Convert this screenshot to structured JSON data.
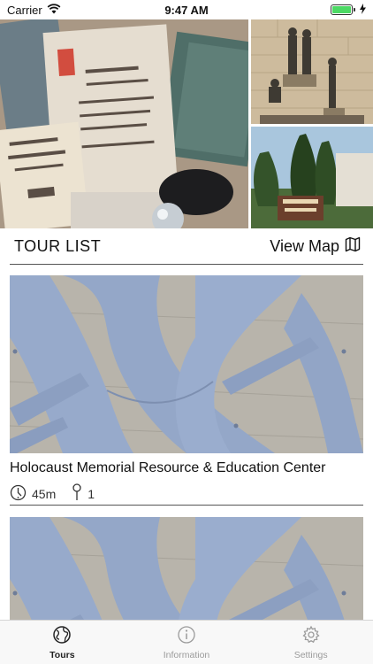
{
  "status_bar": {
    "carrier": "Carrier",
    "time": "9:47 AM",
    "battery_level": 1.0
  },
  "header": {
    "section_title": "TOUR LIST",
    "view_map_label": "View Map",
    "map_icon": "map-icon"
  },
  "tours": [
    {
      "title": "Holocaust Memorial Resource & Education Center",
      "duration": "45m",
      "stops": "1"
    },
    {
      "title": "",
      "duration": "",
      "stops": ""
    }
  ],
  "tab_bar": {
    "tabs": [
      {
        "label": "Tours",
        "icon": "globe-icon",
        "active": true
      },
      {
        "label": "Information",
        "icon": "info-icon",
        "active": false
      },
      {
        "label": "Settings",
        "icon": "gear-icon",
        "active": false
      }
    ]
  },
  "colors": {
    "active_tab": "#222222",
    "inactive_tab": "#9b9b9b",
    "battery": "#4cd964",
    "sculpture_blue": "#97aacb"
  }
}
